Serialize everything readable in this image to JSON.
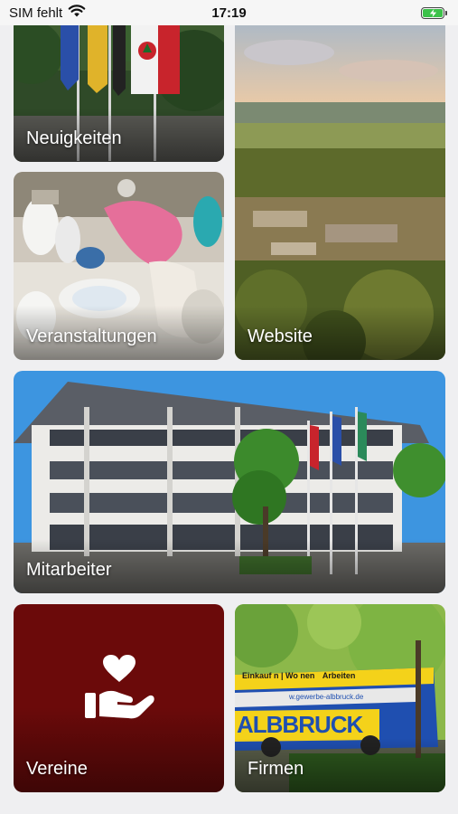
{
  "status_bar": {
    "carrier": "SIM fehlt",
    "time": "17:19",
    "battery_color": "#3cc24a"
  },
  "tiles": {
    "neuigkeiten": {
      "label": "Neuigkeiten"
    },
    "veranstaltungen": {
      "label": "Veranstaltungen"
    },
    "website": {
      "label": "Website"
    },
    "mitarbeiter": {
      "label": "Mitarbeiter"
    },
    "vereine": {
      "label": "Vereine",
      "color": "#6b0a0a"
    },
    "firmen": {
      "label": "Firmen"
    }
  },
  "bus": {
    "headline_left": "Einkauf n | Wo nen",
    "headline_right": "Arbeiten",
    "website": "w.gewerbe-albbruck.de",
    "brand": "ALBBRUCK"
  }
}
